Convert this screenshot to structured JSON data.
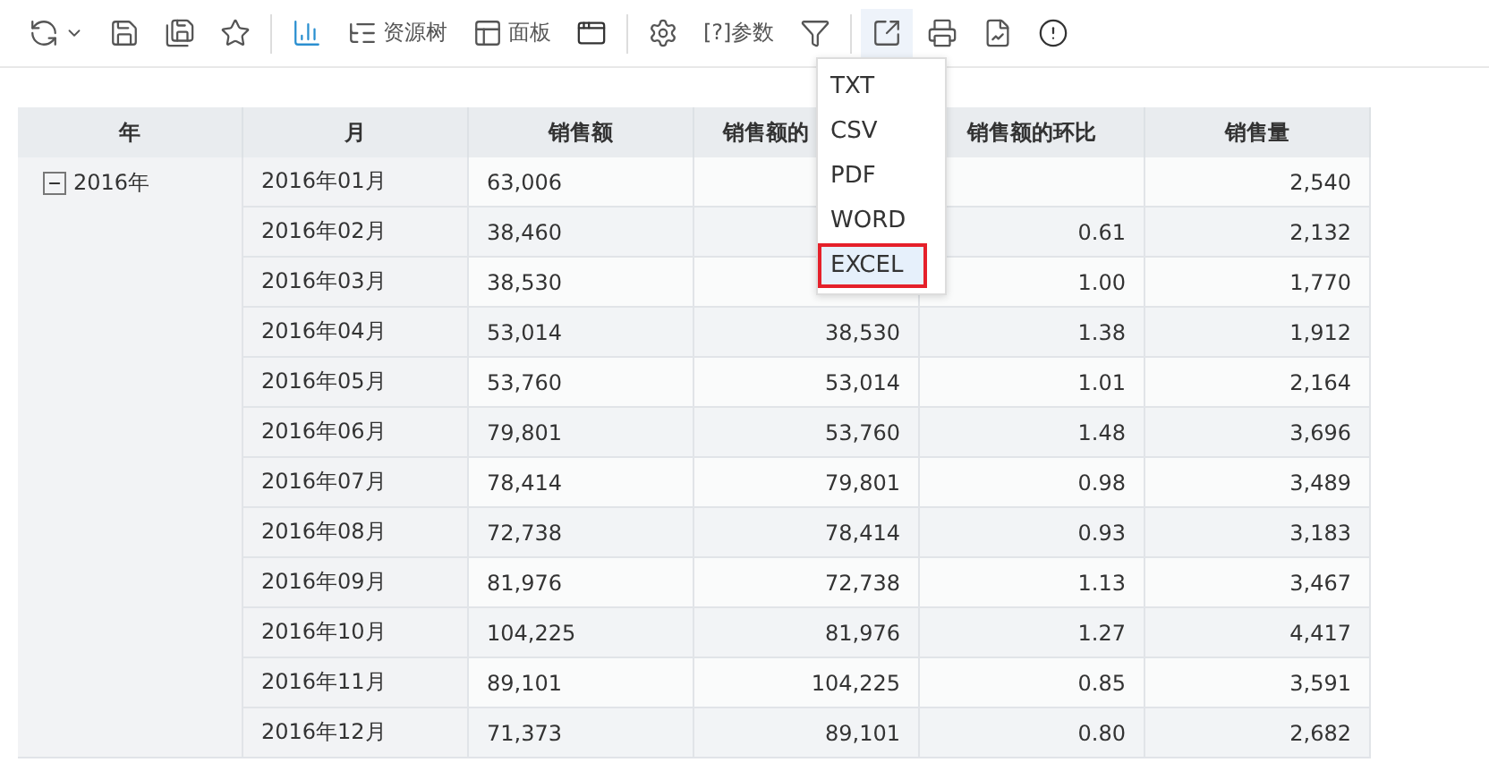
{
  "toolbar": {
    "labels": [
      "资源树",
      "面板",
      "[?]参数"
    ]
  },
  "export_menu": {
    "open": true,
    "items": [
      {
        "label": "TXT",
        "selected": false
      },
      {
        "label": "CSV",
        "selected": false
      },
      {
        "label": "PDF",
        "selected": false
      },
      {
        "label": "WORD",
        "selected": false
      },
      {
        "label": "EXCEL",
        "selected": true
      }
    ]
  },
  "table": {
    "columns": [
      "年",
      "月",
      "销售额",
      "销售额的",
      "销售额的环比",
      "销售量"
    ],
    "groups": [
      {
        "label": "2016年",
        "expanded": true,
        "rows": [
          [
            "2016年01月",
            "63,006",
            "",
            "",
            "2,540"
          ],
          [
            "2016年02月",
            "38,460",
            "",
            "0.61",
            "2,132"
          ],
          [
            "2016年03月",
            "38,530",
            "",
            "1.00",
            "1,770"
          ],
          [
            "2016年04月",
            "53,014",
            "38,530",
            "1.38",
            "1,912"
          ],
          [
            "2016年05月",
            "53,760",
            "53,014",
            "1.01",
            "2,164"
          ],
          [
            "2016年06月",
            "79,801",
            "53,760",
            "1.48",
            "3,696"
          ],
          [
            "2016年07月",
            "78,414",
            "79,801",
            "0.98",
            "3,489"
          ],
          [
            "2016年08月",
            "72,738",
            "78,414",
            "0.93",
            "3,183"
          ],
          [
            "2016年09月",
            "81,976",
            "72,738",
            "1.13",
            "3,467"
          ],
          [
            "2016年10月",
            "104,225",
            "81,976",
            "1.27",
            "4,417"
          ],
          [
            "2016年11月",
            "89,101",
            "104,225",
            "0.85",
            "3,591"
          ],
          [
            "2016年12月",
            "71,373",
            "89,101",
            "0.80",
            "2,682"
          ]
        ]
      }
    ]
  }
}
